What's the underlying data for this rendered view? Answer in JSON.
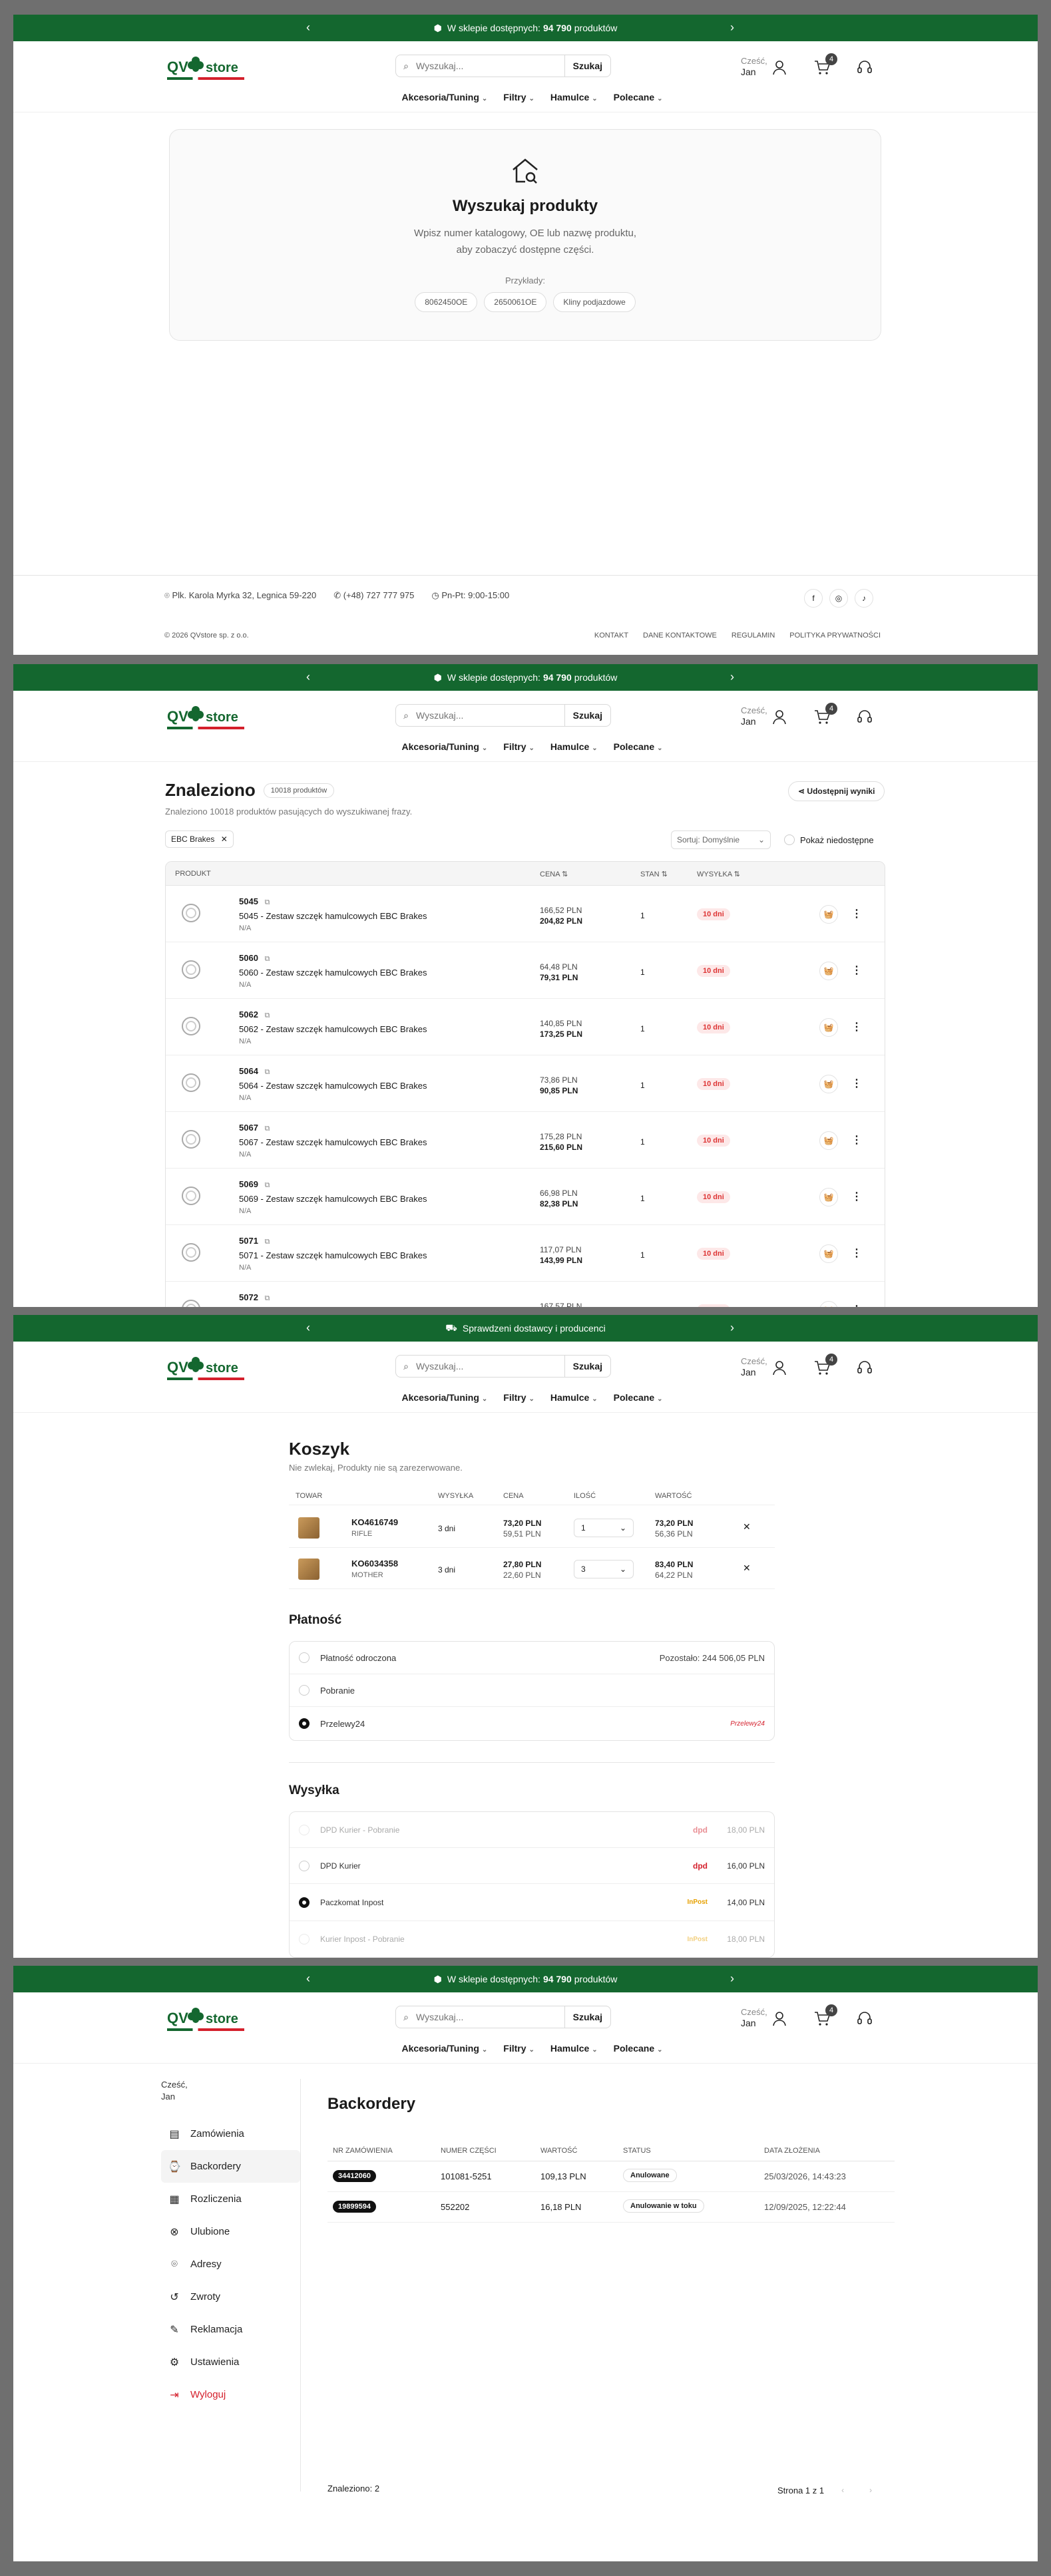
{
  "topbar": {
    "text1_prefix": "W sklepie dostępnych:",
    "text1_count": "94 790",
    "text1_suffix": "produktów",
    "text2": "Sprawdzeni dostawcy i producenci"
  },
  "header": {
    "logo_q": "QV",
    "logo_s": "store",
    "search_placeholder": "Wyszukaj...",
    "search_button": "Szukaj",
    "greeting": "Cześć,",
    "user_name": "Jan",
    "cart_count": "4"
  },
  "nav": [
    "Akcesoria/Tuning",
    "Filtry",
    "Hamulce",
    "Polecane"
  ],
  "empty": {
    "title": "Wyszukaj produkty",
    "desc1": "Wpisz numer katalogowy, OE lub nazwę produktu,",
    "desc2": "aby zobaczyć dostępne części.",
    "examples_label": "Przykłady:",
    "examples": [
      "8062450OE",
      "2650061OE",
      "Kliny podjazdowe"
    ]
  },
  "footer": {
    "address": "Plk. Karola Myrka 32, Legnica 59-220",
    "phone": "(+48) 727 777 975",
    "hours": "Pn-Pt: 9:00-15:00",
    "copyright": "© 2026 QVstore sp. z o.o.",
    "links": [
      "KONTAKT",
      "DANE KONTAKTOWE",
      "REGULAMIN",
      "POLITYKA PRYWATNOŚCI"
    ]
  },
  "results": {
    "title": "Znaleziono",
    "count_badge": "10018 produktów",
    "subtitle": "Znaleziono 10018 produktów pasujących do wyszukiwanej frazy.",
    "share": "Udostępnij wyniki",
    "filter_chip": "EBC Brakes",
    "sort": "Sortuj: Domyślnie",
    "show_unavailable": "Pokaż niedostępne",
    "columns": [
      "PRODUKT",
      "CENA",
      "STAN",
      "WYSYŁKA"
    ],
    "rows": [
      {
        "code": "5045",
        "name": "5045 - Zestaw szczęk hamulcowych EBC Brakes",
        "sub": "N/A",
        "price_net": "166,52 PLN",
        "price_gross": "204,82 PLN",
        "stock": "1",
        "ship": "10 dni"
      },
      {
        "code": "5060",
        "name": "5060 - Zestaw szczęk hamulcowych EBC Brakes",
        "sub": "N/A",
        "price_net": "64,48 PLN",
        "price_gross": "79,31 PLN",
        "stock": "1",
        "ship": "10 dni"
      },
      {
        "code": "5062",
        "name": "5062 - Zestaw szczęk hamulcowych EBC Brakes",
        "sub": "N/A",
        "price_net": "140,85 PLN",
        "price_gross": "173,25 PLN",
        "stock": "1",
        "ship": "10 dni"
      },
      {
        "code": "5064",
        "name": "5064 - Zestaw szczęk hamulcowych EBC Brakes",
        "sub": "N/A",
        "price_net": "73,86 PLN",
        "price_gross": "90,85 PLN",
        "stock": "1",
        "ship": "10 dni"
      },
      {
        "code": "5067",
        "name": "5067 - Zestaw szczęk hamulcowych EBC Brakes",
        "sub": "N/A",
        "price_net": "175,28 PLN",
        "price_gross": "215,60 PLN",
        "stock": "1",
        "ship": "10 dni"
      },
      {
        "code": "5069",
        "name": "5069 - Zestaw szczęk hamulcowych EBC Brakes",
        "sub": "N/A",
        "price_net": "66,98 PLN",
        "price_gross": "82,38 PLN",
        "stock": "1",
        "ship": "10 dni"
      },
      {
        "code": "5071",
        "name": "5071 - Zestaw szczęk hamulcowych EBC Brakes",
        "sub": "N/A",
        "price_net": "117,07 PLN",
        "price_gross": "143,99 PLN",
        "stock": "1",
        "ship": "10 dni"
      },
      {
        "code": "5072",
        "name": "",
        "sub": "",
        "price_net": "167,57 PLN",
        "price_gross": "",
        "stock": "",
        "ship": "10 dni"
      }
    ]
  },
  "cart": {
    "title": "Koszyk",
    "subtitle": "Nie zwlekaj, Produkty nie są zarezerwowane.",
    "columns": [
      "TOWAR",
      "WYSYŁKA",
      "CENA",
      "ILOŚĆ",
      "WARTOŚĆ"
    ],
    "items": [
      {
        "code": "KO4616749",
        "name": "RIFLE",
        "ship": "3 dni",
        "price_gross": "73,20 PLN",
        "price_net": "59,51 PLN",
        "qty": "1",
        "value_gross": "73,20 PLN",
        "value_net": "56,36 PLN"
      },
      {
        "code": "KO6034358",
        "name": "MOTHER",
        "ship": "3 dni",
        "price_gross": "27,80 PLN",
        "price_net": "22,60 PLN",
        "qty": "3",
        "value_gross": "83,40 PLN",
        "value_net": "64,22 PLN"
      }
    ],
    "payment_title": "Płatność",
    "payments": [
      {
        "label": "Płatność odroczona",
        "extra": "Pozostało: 244 506,05 PLN"
      },
      {
        "label": "Pobranie",
        "extra": ""
      },
      {
        "label": "Przelewy24",
        "extra": "Przelewy24"
      }
    ],
    "shipping_title": "Wysyłka",
    "shippings": [
      {
        "label": "DPD Kurier - Pobranie",
        "logo": "dpd",
        "price": "18,00 PLN"
      },
      {
        "label": "DPD Kurier",
        "logo": "dpd",
        "price": "16,00 PLN"
      },
      {
        "label": "Paczkomat Inpost",
        "logo": "InPost",
        "price": "14,00 PLN"
      },
      {
        "label": "Kurier Inpost - Pobranie",
        "logo": "InPost",
        "price": "18,00 PLN"
      }
    ]
  },
  "account": {
    "greeting": "Cześć,",
    "name": "Jan",
    "menu": [
      "Zamówienia",
      "Backordery",
      "Rozliczenia",
      "Ulubione",
      "Adresy",
      "Zwroty",
      "Reklamacja",
      "Ustawienia",
      "Wyloguj"
    ],
    "title": "Backordery",
    "columns": [
      "NR ZAMÓWIENIA",
      "NUMER CZĘŚCI",
      "WARTOŚĆ",
      "STATUS",
      "DATA ZŁOŻENIA"
    ],
    "rows": [
      {
        "order": "34412060",
        "part": "101081-5251",
        "value": "109,13 PLN",
        "status": "Anulowane",
        "date": "25/03/2026, 14:43:23"
      },
      {
        "order": "19899594",
        "part": "552202",
        "value": "16,18 PLN",
        "status": "Anulowanie w toku",
        "date": "12/09/2025, 12:22:44"
      }
    ],
    "found": "Znaleziono: 2",
    "page": "Strona 1 z 1"
  },
  "colors": {
    "brand_green": "#14672f",
    "accent_red": "#d4202c"
  }
}
